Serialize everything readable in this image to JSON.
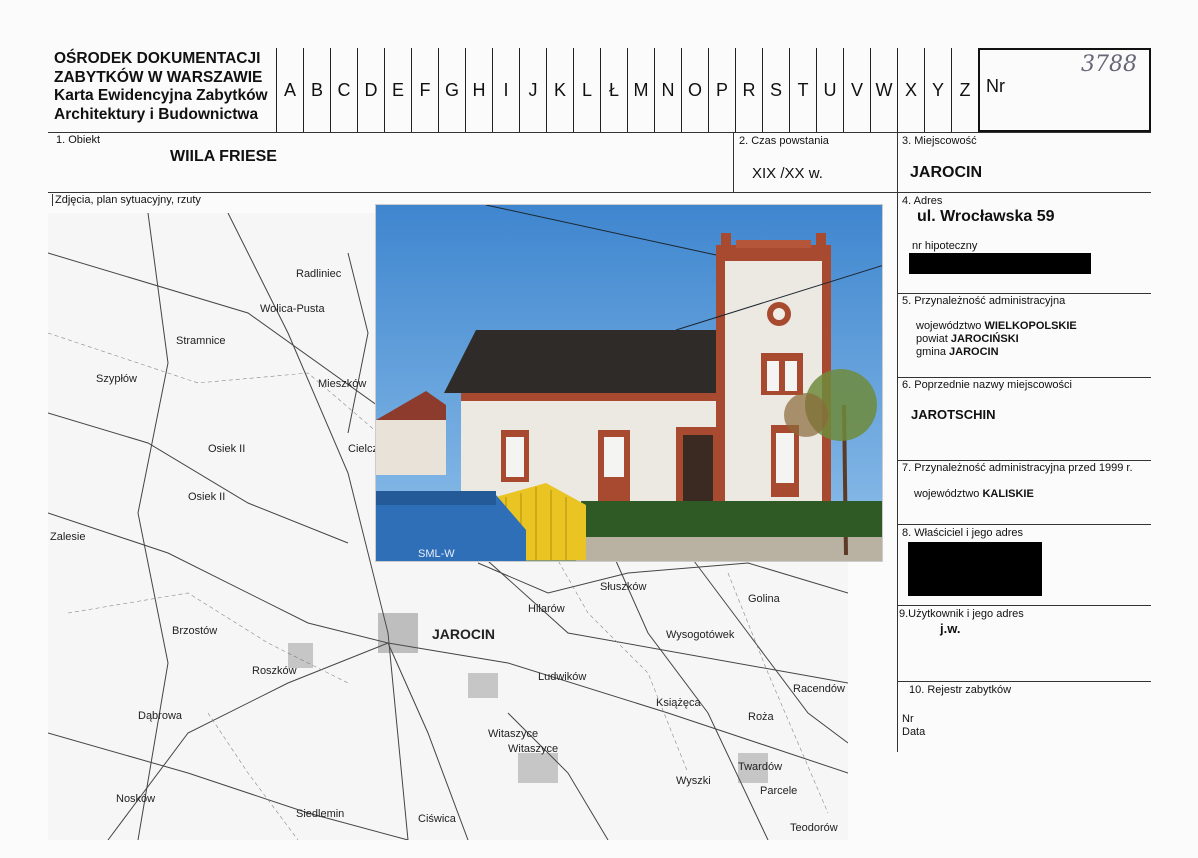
{
  "header": {
    "title_line1": "OŚRODEK DOKUMENTACJI",
    "title_line2": "ZABYTKÓW W WARSZAWIE",
    "title_line3": "Karta Ewidencyjna Zabytków",
    "title_line4": "Architektury i Budownictwa",
    "letters": [
      "A",
      "B",
      "C",
      "D",
      "E",
      "F",
      "G",
      "H",
      "I",
      "J",
      "K",
      "L",
      "Ł",
      "M",
      "N",
      "O",
      "P",
      "R",
      "S",
      "T",
      "U",
      "V",
      "W",
      "X",
      "Y",
      "Z"
    ],
    "nr_label": "Nr",
    "nr_handwritten": "3788"
  },
  "section1": {
    "label": "1.    Obiekt",
    "value": "WIILA FRIESE"
  },
  "section2": {
    "label": "2. Czas powstania",
    "value": "XIX /XX w."
  },
  "section3": {
    "label": "3. Miejscowość",
    "value": "JAROCIN"
  },
  "photos_label": "Zdjęcia, plan sytuacyjny, rzuty",
  "section4": {
    "label": "4. Adres",
    "value": "ul. Wrocławska 59",
    "sub_label": "nr hipoteczny"
  },
  "section5": {
    "label": "5. Przynależność administracyjna",
    "rows": [
      {
        "key": "województwo",
        "value": "WIELKOPOLSKIE"
      },
      {
        "key": "powiat",
        "value": "JAROCIŃSKI"
      },
      {
        "key": "gmina",
        "value": "JAROCIN"
      }
    ]
  },
  "section6": {
    "label": "6. Poprzednie nazwy miejscowości",
    "value": "JAROTSCHIN"
  },
  "section7": {
    "label": "7. Przynależność administracyjna przed 1999 r.",
    "key": "województwo",
    "value": "KALISKIE"
  },
  "section8": {
    "label": "8. Właściciel i jego adres"
  },
  "section9": {
    "label": "9.Użytkownik i jego adres",
    "value": "j.w."
  },
  "section10": {
    "label": "10. Rejestr zabytków",
    "nr": "Nr",
    "data": "Data"
  },
  "photo": {
    "container_text": "SML-W"
  },
  "map": {
    "labels": [
      "Radliniec",
      "Wolica-Pusta",
      "Stramnice",
      "Szypłów",
      "Mieszków",
      "Osiek II",
      "Cielcza",
      "Osiek II",
      "Zalesie",
      "Brzostów",
      "Roszków",
      "Dąbrowa",
      "Nosków",
      "Siedlemin",
      "Ciświca",
      "JAROCIN",
      "Hilarów",
      "Wysogotówek",
      "Witaszyce",
      "Witaszyce",
      "Książęca",
      "Roża",
      "Racendów",
      "Twardów",
      "Parcele",
      "Wyszki",
      "Teodorów",
      "Słuszków",
      "Ludwików",
      "Golina"
    ]
  }
}
